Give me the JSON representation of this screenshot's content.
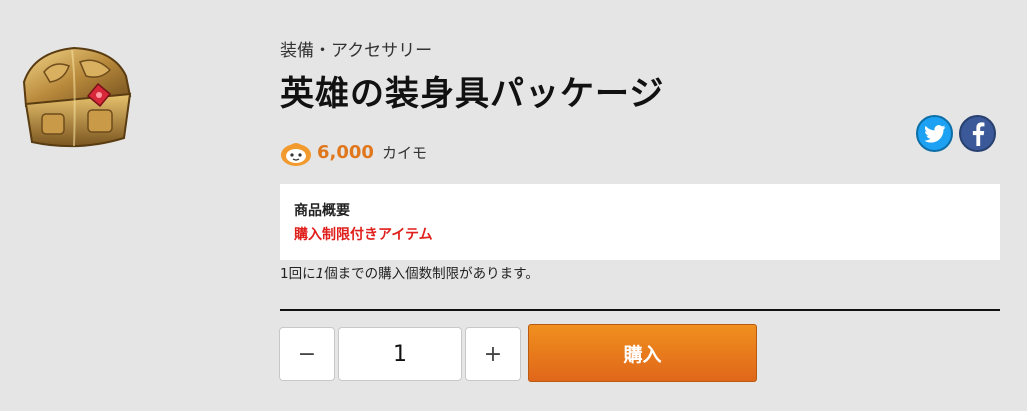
{
  "product": {
    "category": "装備・アクセサリー",
    "title": "英雄の装身具パッケージ",
    "price": "6,000",
    "currency": "カイモ",
    "image_icon": "treasure-chest-icon"
  },
  "social": {
    "twitter_icon": "twitter-icon",
    "facebook_icon": "facebook-icon"
  },
  "summary": {
    "heading": "商品概要",
    "highlight": "購入制限付きアイテム"
  },
  "note": {
    "prefix": "1回に",
    "count": "1",
    "suffix": "個までの購入個数制限があります。"
  },
  "purchase": {
    "minus_label": "−",
    "quantity": "1",
    "plus_label": "+",
    "buy_label": "購入"
  },
  "colors": {
    "accent": "#e0771c",
    "warning": "#e0201c",
    "buy_button": "#e8801c",
    "background": "#e5e5e5"
  }
}
